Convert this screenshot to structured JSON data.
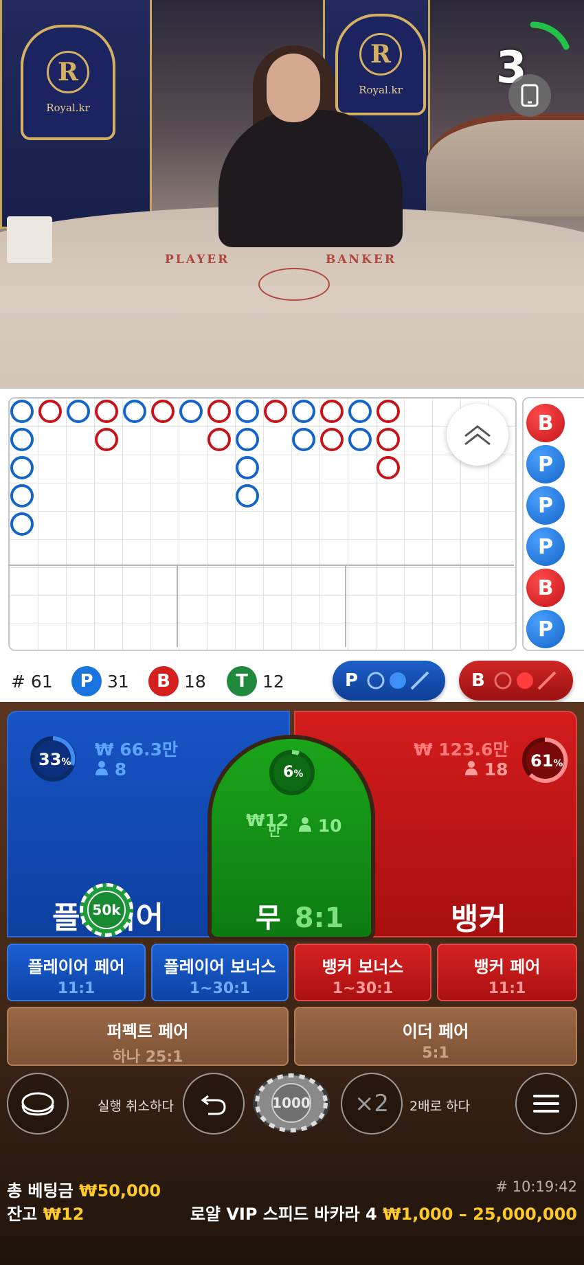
{
  "video": {
    "countdown": "3",
    "table_labels": {
      "player": "PLAYER",
      "banker": "BANKER"
    },
    "logo_text": "Royal.kr",
    "logo_letter": "R",
    "device_icon": "phone-icon"
  },
  "roadmap": {
    "big_road": [
      {
        "col": 0,
        "results": [
          "P",
          "P",
          "P",
          "P",
          "P"
        ]
      },
      {
        "col": 1,
        "results": [
          "B"
        ]
      },
      {
        "col": 2,
        "results": [
          "P"
        ]
      },
      {
        "col": 3,
        "results": [
          "B",
          "B"
        ]
      },
      {
        "col": 4,
        "results": [
          "P"
        ]
      },
      {
        "col": 5,
        "results": [
          "B"
        ]
      },
      {
        "col": 6,
        "results": [
          "P"
        ]
      },
      {
        "col": 7,
        "results": [
          "B",
          "B"
        ]
      },
      {
        "col": 8,
        "results": [
          "P",
          "P",
          "P",
          "P"
        ]
      },
      {
        "col": 9,
        "results": [
          "B"
        ]
      },
      {
        "col": 10,
        "results": [
          "P",
          "P"
        ]
      },
      {
        "col": 11,
        "results": [
          "B",
          "B"
        ]
      },
      {
        "col": 12,
        "results": [
          "P",
          "P"
        ]
      },
      {
        "col": 13,
        "results": [
          "B",
          "B",
          "B"
        ]
      }
    ],
    "bead_column": [
      "B",
      "P",
      "P",
      "P",
      "B",
      "P"
    ],
    "stats": {
      "round_label": "# 61",
      "player_count": "31",
      "banker_count": "18",
      "tie_count": "12"
    },
    "stat_badges": {
      "player": "P",
      "banker": "B",
      "tie": "T"
    },
    "ask_buttons": {
      "player": "P",
      "banker": "B"
    }
  },
  "bets": {
    "player": {
      "label": "플레이어",
      "percent": "33",
      "amount": "₩ 66.3만",
      "players": "8"
    },
    "tie": {
      "label": "무",
      "odds": "8:1",
      "percent": "6",
      "amount_main": "₩12",
      "amount_unit": "만",
      "players": "10"
    },
    "banker": {
      "label": "뱅커",
      "percent": "61",
      "amount": "₩ 123.6만",
      "players": "18"
    },
    "placed_chip": "50k",
    "percent_sign": "%",
    "side_bets": [
      {
        "label": "플레이어 페어",
        "odds": "11:1"
      },
      {
        "label": "플레이어 보너스",
        "odds": "1~30:1"
      },
      {
        "label": "뱅커 보너스",
        "odds": "1~30:1"
      },
      {
        "label": "뱅커 페어",
        "odds": "11:1"
      }
    ],
    "perfect_pair": {
      "label": "퍼펙트 페어",
      "odds": "하나 25:1"
    },
    "either_pair": {
      "label": "이더 페어",
      "odds": "5:1"
    }
  },
  "controls": {
    "undo_label": "실행 취소하다",
    "chip_value": "1000",
    "double_symbol": "×2",
    "double_label": "2배로 하다"
  },
  "footer": {
    "total_bet_label": "총 베팅금",
    "total_bet_value": "₩50,000",
    "balance_label": "잔고",
    "balance_value": "₩12",
    "round_time": "# 10:19:42",
    "table_name": "로얄 VIP 스피드 바카라 4",
    "limits": "₩1,000 – 25,000,000"
  },
  "colors": {
    "player": "#1565c8",
    "banker": "#c4151a",
    "tie": "#1a8a2a",
    "gold": "#ffc928"
  }
}
